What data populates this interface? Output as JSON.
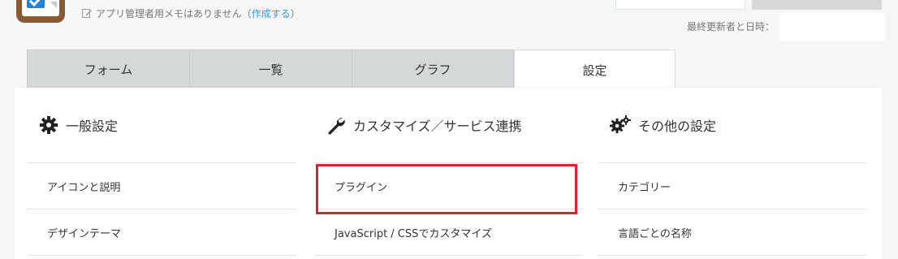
{
  "header": {
    "memo_text": "アプリ管理者用メモはありません",
    "memo_link_open": "（",
    "memo_link": "作成する",
    "memo_link_close": "）",
    "updated_label": "最終更新者と日時："
  },
  "tabs": [
    {
      "label": "フォーム",
      "active": false
    },
    {
      "label": "一覧",
      "active": false
    },
    {
      "label": "グラフ",
      "active": false
    },
    {
      "label": "設定",
      "active": true
    }
  ],
  "sections": [
    {
      "title": "一般設定",
      "icon": "gear-icon",
      "items": [
        "アイコンと説明",
        "デザインテーマ"
      ]
    },
    {
      "title": "カスタマイズ／サービス連携",
      "icon": "wrench-icon",
      "items": [
        "プラグイン",
        "JavaScript / CSSでカスタマイズ"
      ]
    },
    {
      "title": "その他の設定",
      "icon": "gears-icon",
      "items": [
        "カテゴリー",
        "言語ごとの名称"
      ]
    }
  ],
  "colors": {
    "highlight": "#e0202a",
    "link": "#3498db",
    "tab_inactive": "#d5d8d8"
  }
}
